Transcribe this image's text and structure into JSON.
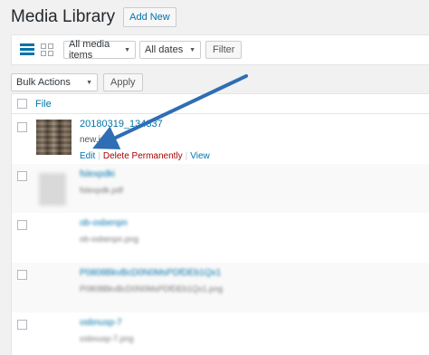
{
  "header": {
    "title": "Media Library",
    "add_new": "Add New"
  },
  "toolbar": {
    "media_filter": "All media items",
    "date_filter": "All dates",
    "filter_button": "Filter"
  },
  "bulk": {
    "action": "Bulk Actions",
    "apply": "Apply"
  },
  "table": {
    "column_file": "File",
    "rows": [
      {
        "title": "20180319_134337",
        "filename": "new.jpg",
        "edit": "Edit",
        "delete": "Delete Permanently",
        "view": "View"
      },
      {
        "title": "fslexpdki",
        "filename": "fslexpdk.pdf"
      },
      {
        "title": "ob-osbenpn",
        "filename": "ob-osbenpn.png"
      },
      {
        "title": "P0808BkvBcD0N0MsPDfDEb1Qx1",
        "filename": "P0808BkvBcD0N0MsPDfDEb1Qx1.png"
      },
      {
        "title": "osbnusp-7",
        "filename": "osbnusp-7.png"
      }
    ]
  },
  "colors": {
    "link": "#0073aa",
    "delete": "#aa0000",
    "arrow": "#2f6db5"
  }
}
